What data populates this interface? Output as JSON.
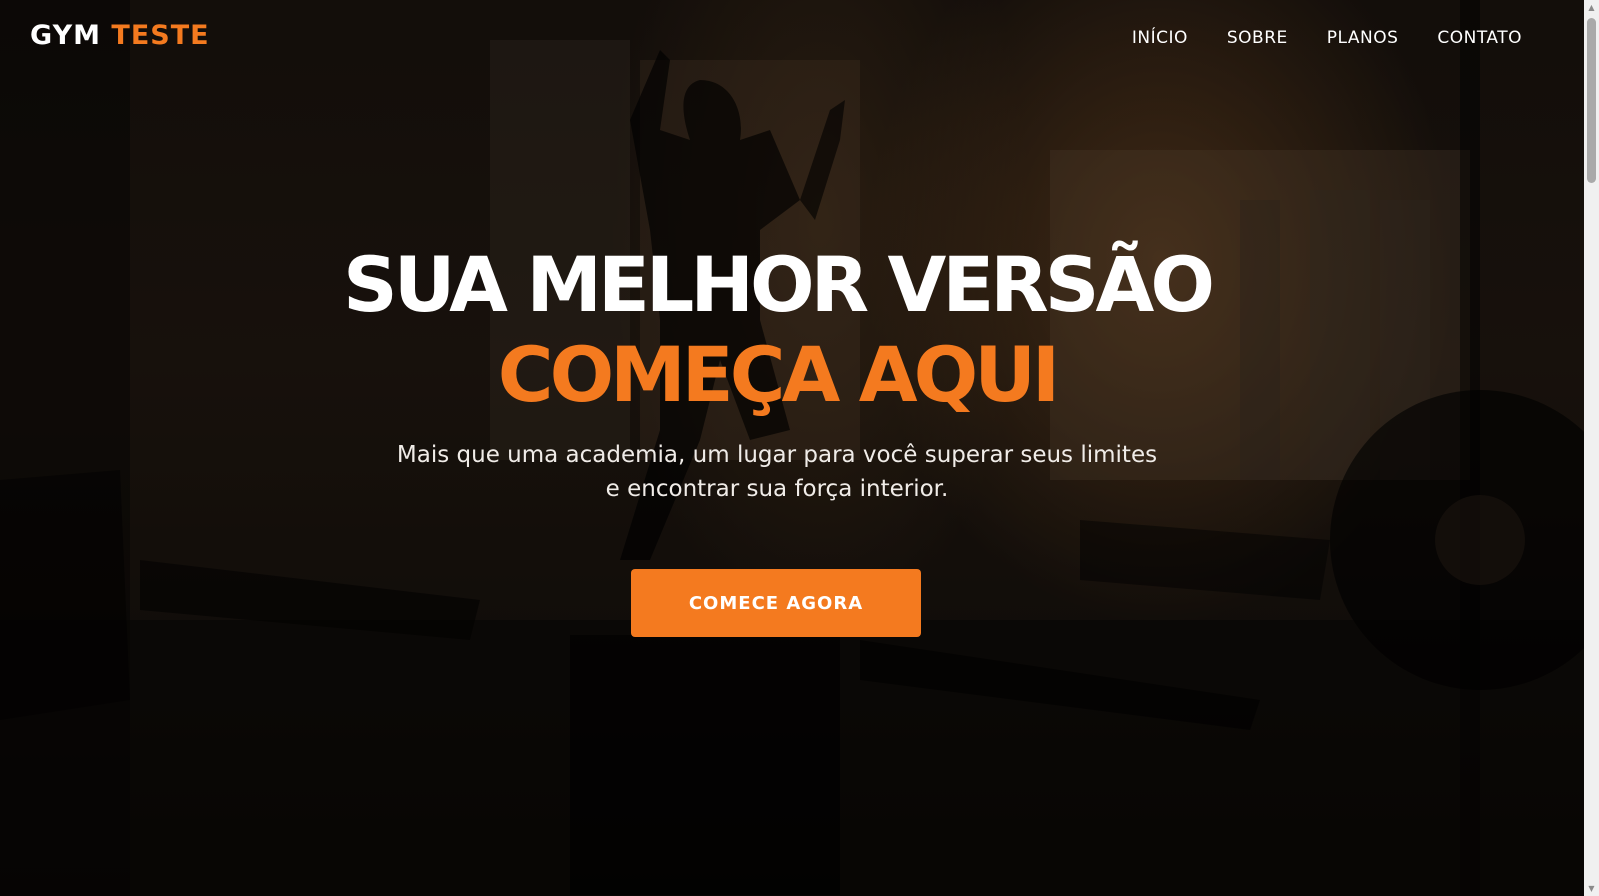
{
  "brand": {
    "name_primary": "GYM",
    "name_accent": "TESTE"
  },
  "nav": {
    "items": [
      "INÍCIO",
      "SOBRE",
      "PLANOS",
      "CONTATO"
    ]
  },
  "hero": {
    "headline": "SUA MELHOR VERSÃO",
    "headline_accent": "COMEÇA AQUI",
    "subtitle_line1": "Mais que uma academia, um lugar para você superar seus limites",
    "subtitle_line2": "e encontrar sua força interior.",
    "cta_label": "COMECE AGORA",
    "background_image": "gym-silhouette-photo"
  },
  "colors": {
    "accent": "#f47a1f",
    "text": "#ffffff",
    "background": "#1a140f"
  }
}
